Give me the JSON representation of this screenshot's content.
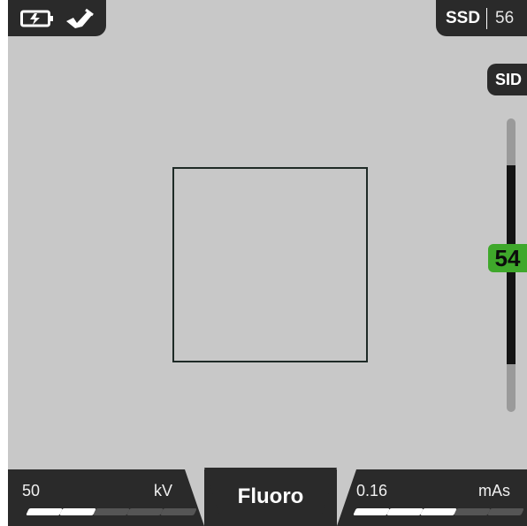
{
  "status": {
    "icons": [
      "battery-charging-icon",
      "foot-pedal-icon"
    ]
  },
  "ssd": {
    "label": "SSD",
    "value": "56"
  },
  "sid": {
    "label": "SID",
    "value": "54"
  },
  "controls": {
    "kv": {
      "value": "50",
      "unit": "kV",
      "level_filled": 2,
      "level_total": 5
    },
    "mode": {
      "label": "Fluoro"
    },
    "mas": {
      "value": "0.16",
      "unit": "mAs",
      "level_filled": 3,
      "level_total": 5
    }
  },
  "colors": {
    "background": "#c8c8c8",
    "panel": "#2a2a2a",
    "accent_green": "#3fa82b",
    "bar_filled": "#ffffff",
    "bar_empty": "#555555"
  }
}
